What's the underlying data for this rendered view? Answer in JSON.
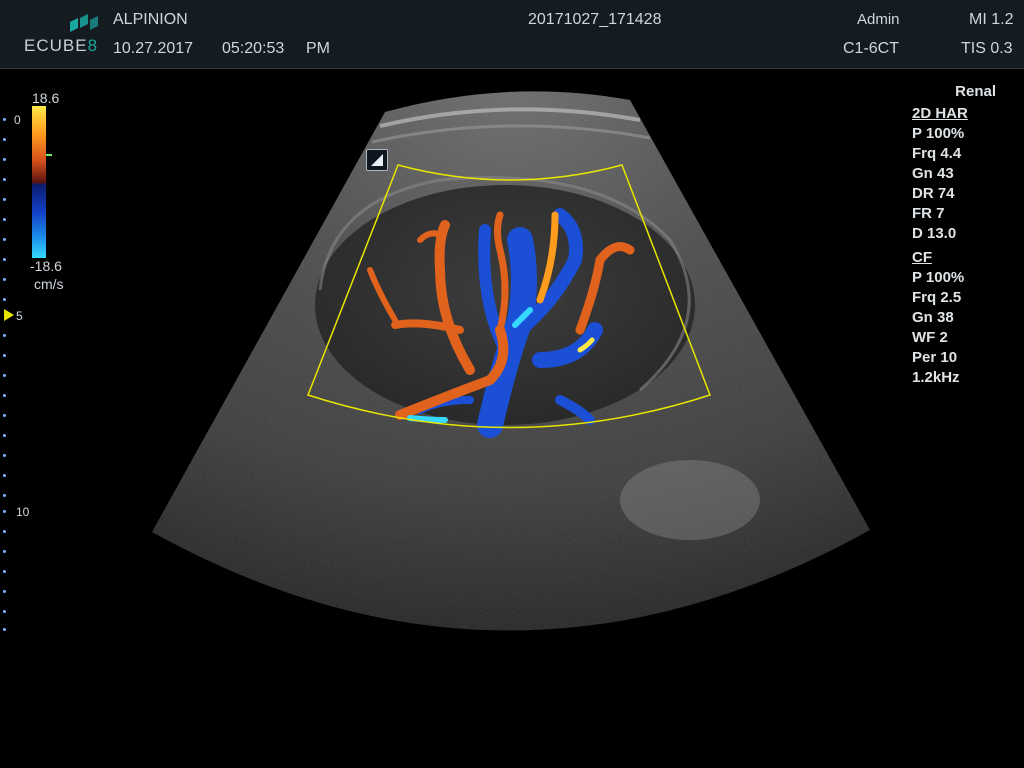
{
  "header": {
    "brand_line1": "ALPINION",
    "brand_logo_prefix": "ECUBE",
    "brand_logo_suffix": "8",
    "date": "10.27.2017",
    "time": "05:20:53",
    "ampm": "PM",
    "study_id": "20171027_171428",
    "user": "Admin",
    "probe": "C1-6CT",
    "mi": "MI 1.2",
    "tis": "TIS 0.3"
  },
  "color_scale": {
    "max": "18.6",
    "min": "-18.6",
    "unit": "cm/s"
  },
  "depth_scale": {
    "labels": [
      "0",
      "5",
      "10"
    ]
  },
  "preset": "Renal",
  "mode_2d": {
    "title": "2D HAR",
    "params": [
      "P 100%",
      "Frq 4.4",
      "Gn 43",
      "DR 74",
      "FR 7",
      "D 13.0"
    ]
  },
  "mode_cf": {
    "title": "CF",
    "params": [
      "P 100%",
      "Frq 2.5",
      "Gn 38",
      "WF 2",
      "Per 10",
      "1.2kHz"
    ]
  },
  "colors": {
    "header_bg": "#141c22",
    "roi_box": "#e6e600",
    "flow_red": "#e0621c",
    "flow_blue": "#1a4fd6",
    "logo_accent": "#1aa7a0"
  },
  "icons": {
    "orientation_marker": "orientation-marker-icon",
    "logo": "ecube-logo-icon"
  }
}
